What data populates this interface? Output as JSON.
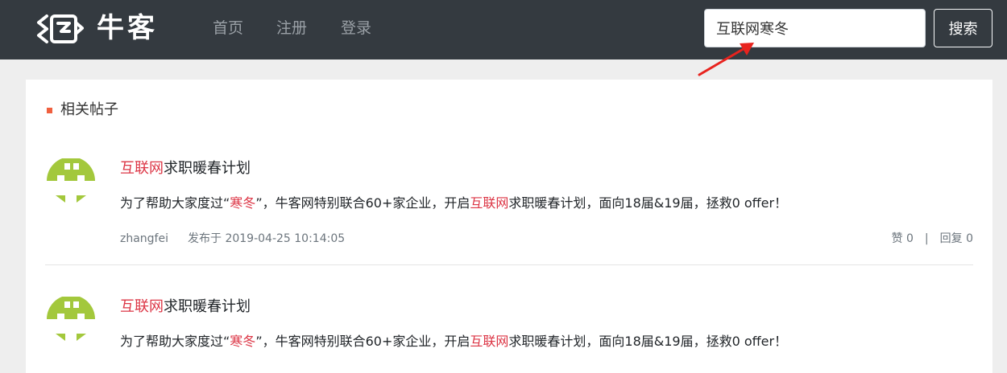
{
  "header": {
    "logo_text": "牛客",
    "nav": [
      {
        "label": "首页"
      },
      {
        "label": "注册"
      },
      {
        "label": "登录"
      }
    ],
    "search": {
      "value": "互联网寒冬",
      "button_label": "搜索"
    }
  },
  "section": {
    "title": "相关帖子"
  },
  "posts": [
    {
      "title_highlight": "互联网",
      "title_rest": "求职暖春计划",
      "body_1": "为了帮助大家度过“",
      "body_hl_1": "寒冬",
      "body_2": "”，牛客网特别联合60+家企业，开启",
      "body_hl_2": "互联网",
      "body_3": "求职暖春计划，面向18届&19届，拯救0 offer！",
      "author": "zhangfei",
      "published": "发布于 2019-04-25 10:14:05",
      "likes": "赞 0",
      "separator": "|",
      "replies": "回复 0"
    },
    {
      "title_highlight": "互联网",
      "title_rest": "求职暖春计划",
      "body_1": "为了帮助大家度过“",
      "body_hl_1": "寒冬",
      "body_2": "”，牛客网特别联合60+家企业，开启",
      "body_hl_2": "互联网",
      "body_3": "求职暖春计划，面向18届&19届，拯救0 offer！"
    }
  ],
  "colors": {
    "navbar_bg": "#343a40",
    "highlight": "#dc3545",
    "avatar_green": "#a3c83c",
    "annotation_arrow": "#e8231e"
  }
}
